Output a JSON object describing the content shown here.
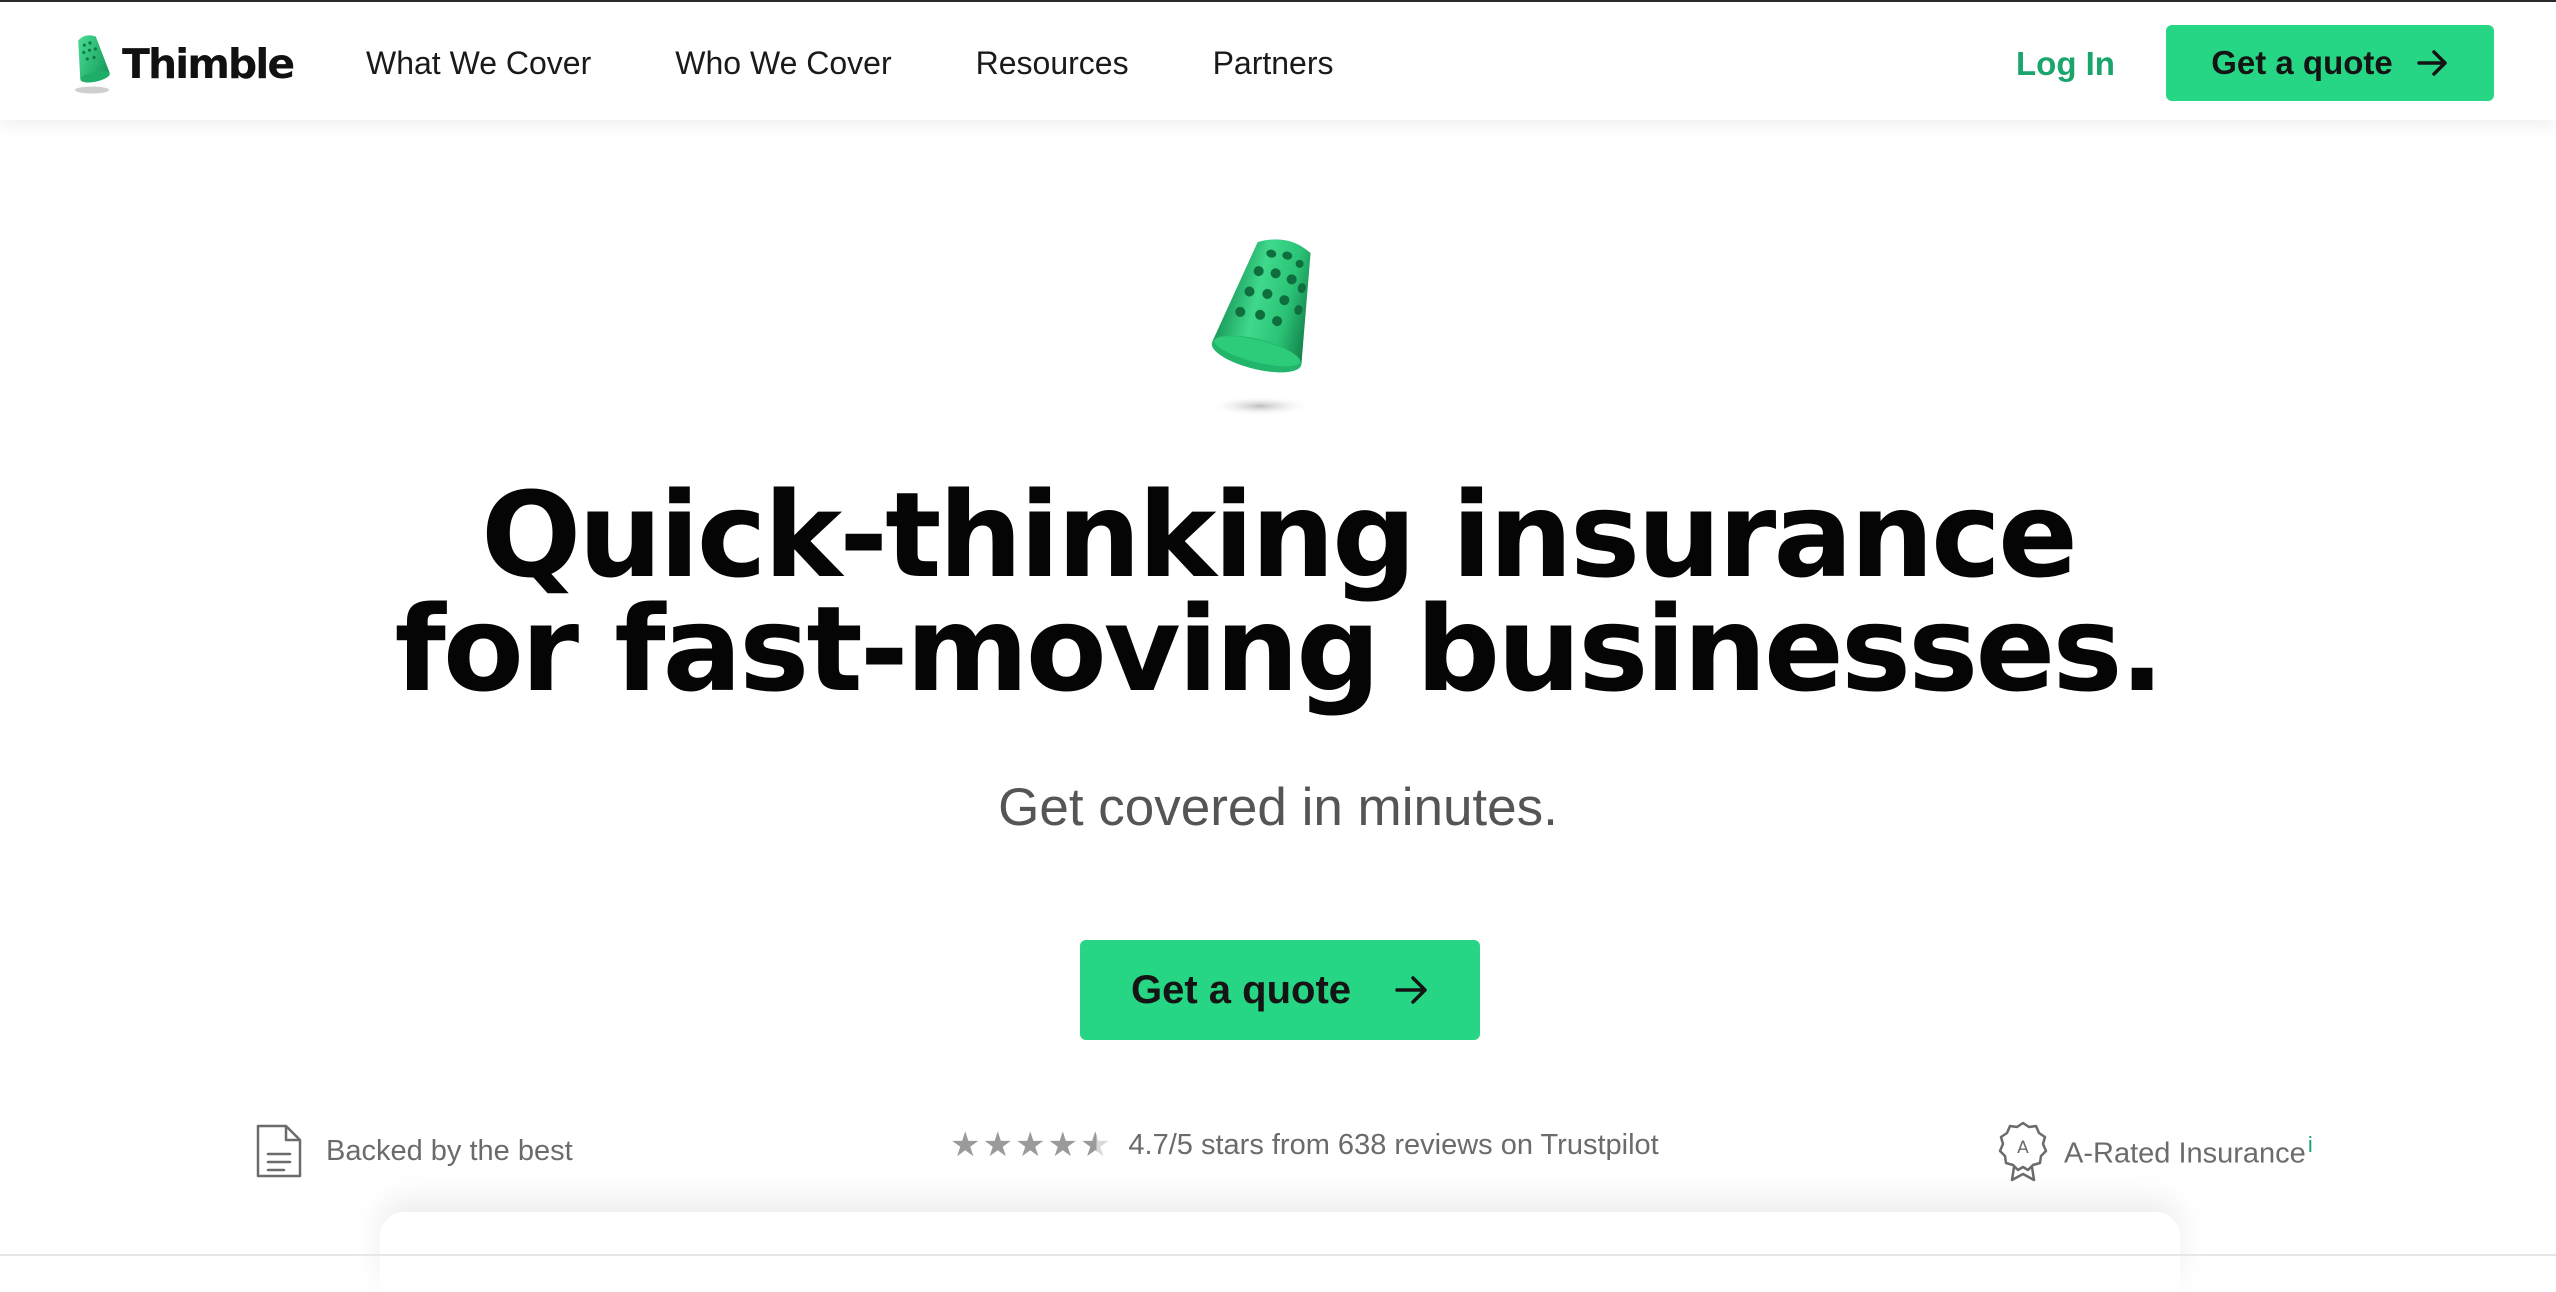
{
  "brand": {
    "name": "Thimble"
  },
  "nav": {
    "items": [
      {
        "label": "What We Cover"
      },
      {
        "label": "Who We Cover"
      },
      {
        "label": "Resources"
      },
      {
        "label": "Partners"
      }
    ],
    "login_label": "Log In",
    "cta_label": "Get a quote"
  },
  "hero": {
    "headline_line1": "Quick-thinking insurance",
    "headline_line2": "for fast-moving businesses.",
    "subheadline": "Get covered in minutes.",
    "cta_label": "Get a quote"
  },
  "trust": {
    "backed_label": "Backed by the best",
    "rating_text": "4.7/5 stars from 638 reviews on Trustpilot",
    "rating_value": 4.7,
    "rating_max": 5,
    "rated_label": "A-Rated Insurance",
    "rated_info_marker": "i",
    "badge_letter": "A"
  },
  "colors": {
    "accent": "#27d684",
    "link": "#1aa56c",
    "text": "#111111",
    "muted": "#6b6b6b"
  },
  "icons": {
    "logo": "thimble-logo-icon",
    "hero": "thimble-illustration-icon",
    "arrow": "arrow-right-icon",
    "document": "document-icon",
    "star": "star-icon",
    "badge": "award-badge-icon"
  }
}
